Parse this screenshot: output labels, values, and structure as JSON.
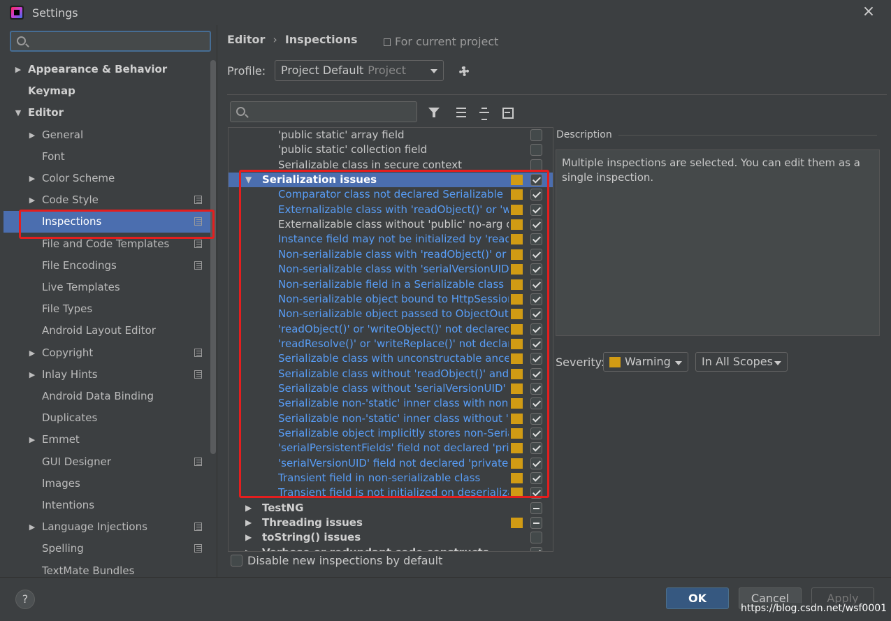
{
  "window": {
    "title": "Settings",
    "close": "×"
  },
  "sidebar": {
    "search_placeholder": "",
    "items": [
      {
        "label": "Appearance & Behavior",
        "bold": true,
        "arrow": "▶",
        "level": 0
      },
      {
        "label": "Keymap",
        "bold": true,
        "arrow": "",
        "level": 0
      },
      {
        "label": "Editor",
        "bold": true,
        "arrow": "▼",
        "level": 0
      },
      {
        "label": "General",
        "arrow": "▶",
        "level": 1
      },
      {
        "label": "Font",
        "arrow": "",
        "level": 1
      },
      {
        "label": "Color Scheme",
        "arrow": "▶",
        "level": 1
      },
      {
        "label": "Code Style",
        "arrow": "▶",
        "level": 1,
        "project": true
      },
      {
        "label": "Inspections",
        "arrow": "",
        "level": 1,
        "project": true,
        "selected": true
      },
      {
        "label": "File and Code Templates",
        "arrow": "",
        "level": 1,
        "project": true
      },
      {
        "label": "File Encodings",
        "arrow": "",
        "level": 1,
        "project": true
      },
      {
        "label": "Live Templates",
        "arrow": "",
        "level": 1
      },
      {
        "label": "File Types",
        "arrow": "",
        "level": 1
      },
      {
        "label": "Android Layout Editor",
        "arrow": "",
        "level": 1
      },
      {
        "label": "Copyright",
        "arrow": "▶",
        "level": 1,
        "project": true
      },
      {
        "label": "Inlay Hints",
        "arrow": "▶",
        "level": 1,
        "project": true
      },
      {
        "label": "Android Data Binding",
        "arrow": "",
        "level": 1
      },
      {
        "label": "Duplicates",
        "arrow": "",
        "level": 1
      },
      {
        "label": "Emmet",
        "arrow": "▶",
        "level": 1
      },
      {
        "label": "GUI Designer",
        "arrow": "",
        "level": 1,
        "project": true
      },
      {
        "label": "Images",
        "arrow": "",
        "level": 1
      },
      {
        "label": "Intentions",
        "arrow": "",
        "level": 1
      },
      {
        "label": "Language Injections",
        "arrow": "▶",
        "level": 1,
        "project": true
      },
      {
        "label": "Spelling",
        "arrow": "",
        "level": 1,
        "project": true
      },
      {
        "label": "TextMate Bundles",
        "arrow": "",
        "level": 1
      }
    ]
  },
  "header": {
    "crumb1": "Editor",
    "crumb_sep": "›",
    "crumb2": "Inspections",
    "for_project": "For current project",
    "profile_label": "Profile:",
    "profile_value": "Project Default",
    "profile_scope": "Project"
  },
  "inspections": {
    "search_placeholder": "",
    "rows": [
      {
        "label": "'public static' array field",
        "style": "plain",
        "check": "off"
      },
      {
        "label": "'public static' collection field",
        "style": "plain",
        "check": "off"
      },
      {
        "label": "Serializable class in secure context",
        "style": "plain",
        "check": "off"
      },
      {
        "label": "Serialization issues",
        "style": "cat",
        "arrow": "▼",
        "check": "on",
        "sev": true,
        "selected": true
      },
      {
        "label": "Comparator class not declared Serializable",
        "style": "link",
        "check": "on",
        "sev": true
      },
      {
        "label": "Externalizable class with 'readObject()' or 'writeObject()'",
        "style": "link",
        "check": "on",
        "sev": true
      },
      {
        "label": "Externalizable class without 'public' no-arg constructor",
        "style": "plain",
        "check": "on",
        "sev": true
      },
      {
        "label": "Instance field may not be initialized by 'readObject()'",
        "style": "link",
        "check": "on",
        "sev": true
      },
      {
        "label": "Non-serializable class with 'readObject()' or 'writeObject()'",
        "style": "link",
        "check": "on",
        "sev": true
      },
      {
        "label": "Non-serializable class with 'serialVersionUID'",
        "style": "link",
        "check": "on",
        "sev": true
      },
      {
        "label": "Non-serializable field in a Serializable class",
        "style": "link",
        "check": "on",
        "sev": true
      },
      {
        "label": "Non-serializable object bound to HttpSession",
        "style": "link",
        "check": "on",
        "sev": true
      },
      {
        "label": "Non-serializable object passed to ObjectOutputStream",
        "style": "link",
        "check": "on",
        "sev": true
      },
      {
        "label": "'readObject()' or 'writeObject()' not declared 'private'",
        "style": "link",
        "check": "on",
        "sev": true
      },
      {
        "label": "'readResolve()' or 'writeReplace()' not declared 'protected'",
        "style": "link",
        "check": "on",
        "sev": true
      },
      {
        "label": "Serializable class with unconstructable ancestor",
        "style": "link",
        "check": "on",
        "sev": true
      },
      {
        "label": "Serializable class without 'readObject()' and 'writeObject()'",
        "style": "link",
        "check": "on",
        "sev": true
      },
      {
        "label": "Serializable class without 'serialVersionUID'",
        "style": "link",
        "check": "on",
        "sev": true
      },
      {
        "label": "Serializable non-'static' inner class with non-Serializable outer class",
        "style": "link",
        "check": "on",
        "sev": true
      },
      {
        "label": "Serializable non-'static' inner class without 'serialVersionUID'",
        "style": "link",
        "check": "on",
        "sev": true
      },
      {
        "label": "Serializable object implicitly stores non-Serializable object",
        "style": "link",
        "check": "on",
        "sev": true
      },
      {
        "label": "'serialPersistentFields' field not declared 'private static final'",
        "style": "link",
        "check": "on",
        "sev": true
      },
      {
        "label": "'serialVersionUID' field not declared 'private static final long'",
        "style": "link",
        "check": "on",
        "sev": true
      },
      {
        "label": "Transient field in non-serializable class",
        "style": "link",
        "check": "on",
        "sev": true
      },
      {
        "label": "Transient field is not initialized on deserialization",
        "style": "link",
        "check": "on",
        "sev": true
      },
      {
        "label": "TestNG",
        "style": "cat",
        "arrow": "▶",
        "check": "ind",
        "sev": false
      },
      {
        "label": "Threading issues",
        "style": "cat",
        "arrow": "▶",
        "check": "ind",
        "sev": true
      },
      {
        "label": "toString() issues",
        "style": "cat",
        "arrow": "▶",
        "check": "off",
        "sev": false
      },
      {
        "label": "Verbose or redundant code constructs",
        "style": "cat",
        "arrow": "▶",
        "check": "on",
        "sev": false
      }
    ],
    "disable_label": "Disable new inspections by default"
  },
  "description": {
    "title": "Description",
    "text": "Multiple inspections are selected. You can edit them as a single inspection.",
    "severity_label": "Severity:",
    "severity_value": "Warning",
    "scope_value": "In All Scopes"
  },
  "buttons": {
    "help": "?",
    "ok": "OK",
    "cancel": "Cancel",
    "apply": "Apply"
  },
  "watermark": "https://blog.csdn.net/wsf0001",
  "colors": {
    "selection": "#4b6eaf",
    "link": "#589df6",
    "warning": "#d19b14",
    "highlight": "#e41e1e"
  }
}
